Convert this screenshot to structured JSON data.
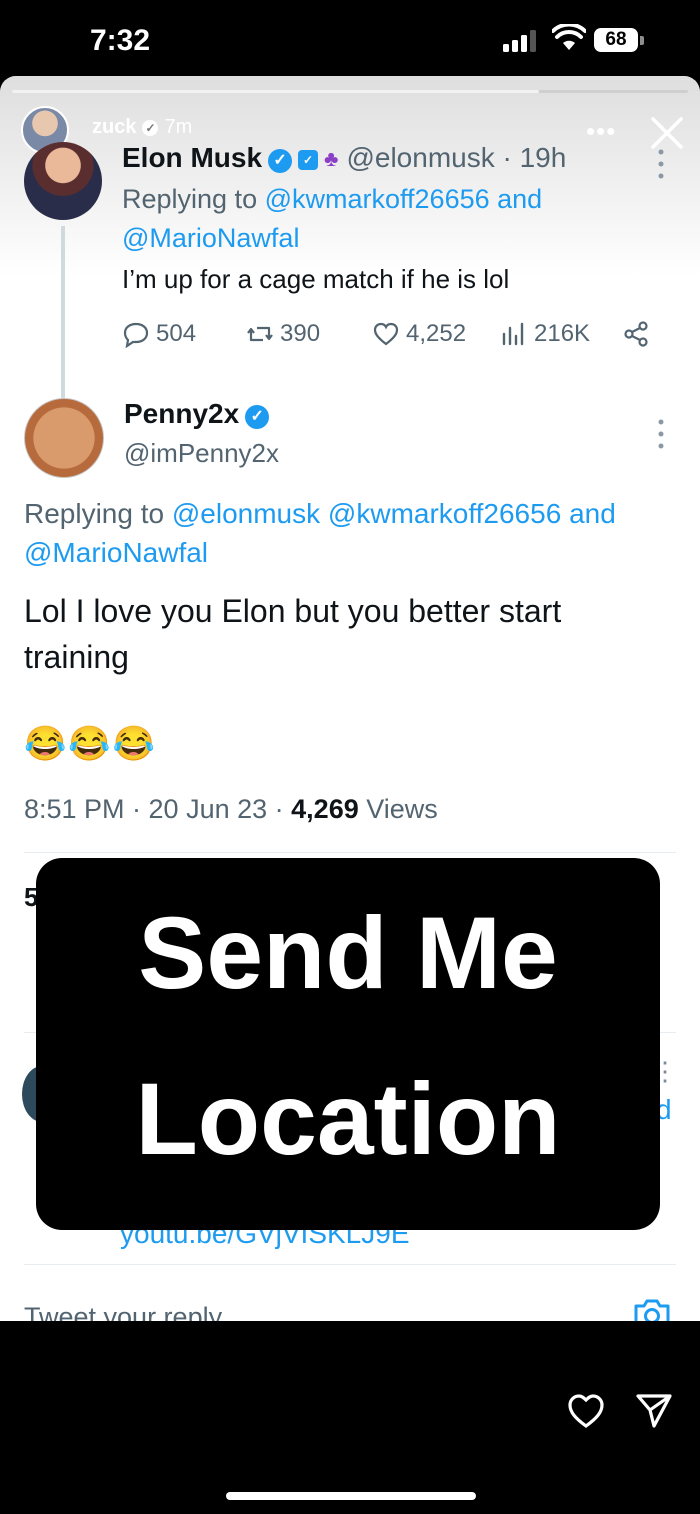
{
  "status_bar": {
    "time": "7:32",
    "battery": "68"
  },
  "story": {
    "username": "zuck",
    "time_ago": "7m",
    "more": "•••",
    "progress_fraction": 0.78
  },
  "quoted_tweet": {
    "name": "Elon Musk",
    "handle": "@elonmusk",
    "time": "· 19h",
    "replying_prefix": "Replying to ",
    "replying_to_1": "@kwmarkoff26656",
    "replying_join": " and",
    "replying_to_2": "@MarioNawfal",
    "text": "I’m up for a cage match if he is lol",
    "replies": "504",
    "retweets": "390",
    "likes": "4,252",
    "views": "216K"
  },
  "main_tweet": {
    "name": "Penny2x",
    "handle": "@imPenny2x",
    "replying_prefix": "Replying to ",
    "replying_to_1": "@elonmusk",
    "replying_to_2": "@kwmarkoff26656",
    "replying_join": "and",
    "replying_to_3": "@MarioNawfal",
    "text": "Lol I love you Elon but you better start training",
    "emoji": "😂😂😂",
    "time": "8:51 PM · 20 Jun 23 ·",
    "views_count": "4,269",
    "views_label": " Views"
  },
  "partial": {
    "stats_digit": "5",
    "link": "youtu.be/GVjVISKLJ9E",
    "link_right": "d"
  },
  "compose": {
    "placeholder": "Tweet your reply"
  },
  "overlay": {
    "line1": "Send Me",
    "line2": "Location"
  }
}
